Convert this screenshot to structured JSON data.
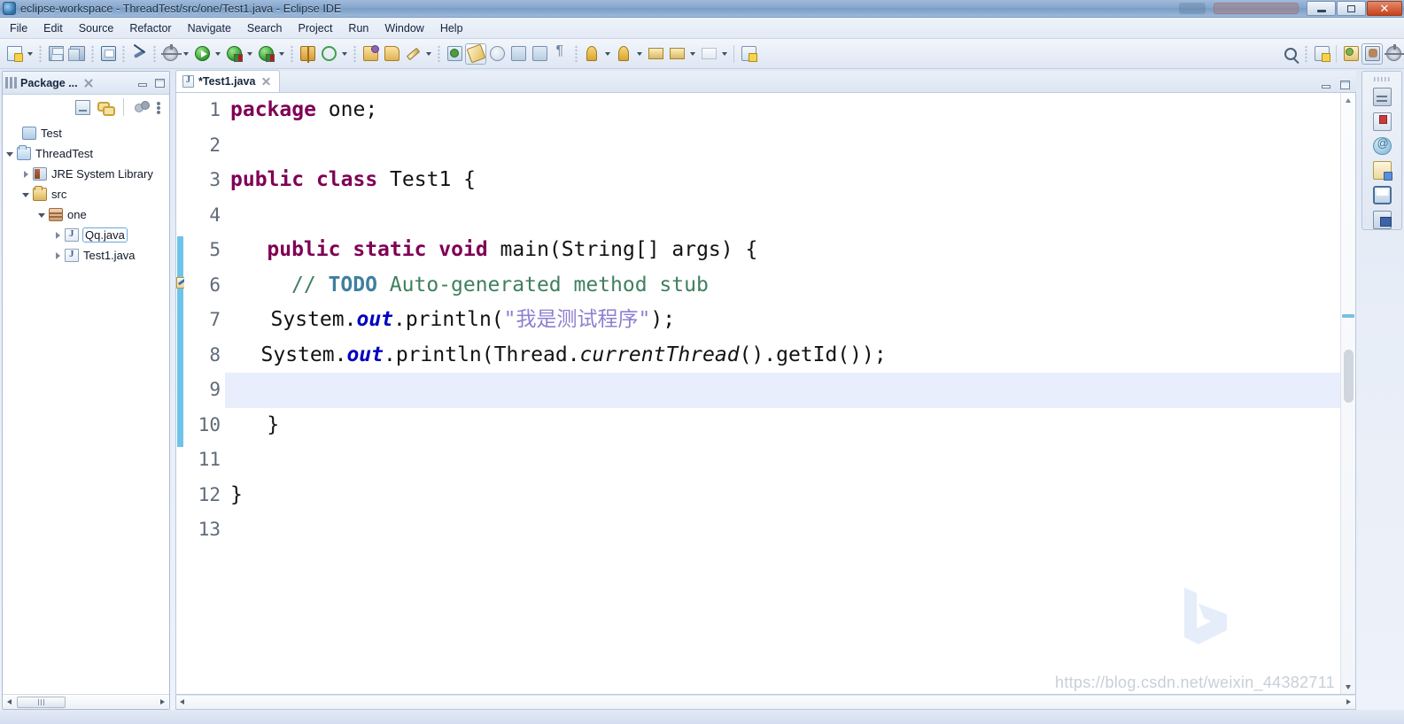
{
  "window": {
    "title": "eclipse-workspace - ThreadTest/src/one/Test1.java - Eclipse IDE",
    "app_icon": "eclipse-icon",
    "minimize_label": "",
    "maximize_label": "",
    "close_label": "✕"
  },
  "menubar": {
    "items": [
      {
        "label": "File",
        "name": "menu-file"
      },
      {
        "label": "Edit",
        "name": "menu-edit"
      },
      {
        "label": "Source",
        "name": "menu-source"
      },
      {
        "label": "Refactor",
        "name": "menu-refactor"
      },
      {
        "label": "Navigate",
        "name": "menu-navigate"
      },
      {
        "label": "Search",
        "name": "menu-search"
      },
      {
        "label": "Project",
        "name": "menu-project"
      },
      {
        "label": "Run",
        "name": "menu-run"
      },
      {
        "label": "Window",
        "name": "menu-window"
      },
      {
        "label": "Help",
        "name": "menu-help"
      }
    ]
  },
  "toolbar": {
    "icons": [
      "new-file-icon",
      "save-icon",
      "save-all-icon",
      "print-icon",
      "skip-all-breakpoints-icon",
      "debug-icon",
      "run-icon",
      "run-as-icon",
      "debug-as-icon",
      "external-tools-icon",
      "refresh-icon",
      "open-resource-icon",
      "new-package-icon",
      "new-java-project-icon",
      "new-class-icon",
      "edit-icon",
      "open-type-icon",
      "toggle-markoccurrences-icon",
      "link-icon",
      "next-annotation-icon",
      "previous-annotation-icon",
      "last-edit-location-icon",
      "back-icon",
      "forward-icon",
      "open-perspective-icon",
      "search-icon",
      "new-window-icon",
      "perspective-java-icon",
      "perspective-debug-icon",
      "perspective-extra-icon"
    ]
  },
  "explorer": {
    "tab_label": "Package ...",
    "tab_icon": "package-explorer-icon",
    "close_icon": "close-icon",
    "minimize_icon": "minimize-icon",
    "maximize_icon": "maximize-icon",
    "tools": [
      "collapse-all-icon",
      "link-with-editor-icon",
      "focus-on-active-task-icon",
      "view-menu-icon"
    ],
    "tree": [
      {
        "label": "Test",
        "icon": "project-closed-icon",
        "indent": 0,
        "twisty": "none",
        "selected": false
      },
      {
        "label": "ThreadTest",
        "icon": "project-open-icon",
        "indent": 0,
        "twisty": "open",
        "selected": false
      },
      {
        "label": "JRE System Library",
        "icon": "library-icon",
        "indent": 1,
        "twisty": "closed",
        "selected": false
      },
      {
        "label": "src",
        "icon": "source-folder-icon",
        "indent": 1,
        "twisty": "open",
        "selected": false
      },
      {
        "label": "one",
        "icon": "package-icon",
        "indent": 2,
        "twisty": "open",
        "selected": false
      },
      {
        "label": "Qq.java",
        "icon": "java-file-icon",
        "indent": 3,
        "twisty": "closed",
        "selected": true
      },
      {
        "label": "Test1.java",
        "icon": "java-file-icon",
        "indent": 3,
        "twisty": "closed",
        "selected": false
      }
    ],
    "scroll_left_icon": "scroll-left-icon",
    "scroll_right_icon": "scroll-right-icon"
  },
  "editor": {
    "tab_label": "*Test1.java",
    "tab_icon": "java-file-icon",
    "tab_close_icon": "close-icon",
    "minimize_icon": "minimize-icon",
    "maximize_icon": "maximize-icon",
    "current_line": 9,
    "line_numbers": [
      "1",
      "2",
      "3",
      "4",
      "5",
      "6",
      "7",
      "8",
      "9",
      "10",
      "11",
      "12",
      "13"
    ],
    "fold_marker_line": 5,
    "lines": [
      {
        "n": "1",
        "indent": 0,
        "tokens": [
          {
            "t": "package",
            "c": "kw"
          },
          {
            "t": " one;",
            "c": ""
          }
        ]
      },
      {
        "n": "2",
        "indent": 0,
        "tokens": []
      },
      {
        "n": "3",
        "indent": 0,
        "tokens": [
          {
            "t": "public",
            "c": "kw"
          },
          {
            "t": " ",
            "c": ""
          },
          {
            "t": "class",
            "c": "kw"
          },
          {
            "t": " Test1 {",
            "c": ""
          }
        ]
      },
      {
        "n": "4",
        "indent": 0,
        "tokens": []
      },
      {
        "n": "5",
        "indent": 3,
        "tokens": [
          {
            "t": "public",
            "c": "kw"
          },
          {
            "t": " ",
            "c": ""
          },
          {
            "t": "static",
            "c": "kw"
          },
          {
            "t": " ",
            "c": ""
          },
          {
            "t": "void",
            "c": "kw"
          },
          {
            "t": " main(String[] args) {",
            "c": ""
          }
        ]
      },
      {
        "n": "6",
        "indent": 5,
        "tokens": [
          {
            "t": "// ",
            "c": "cmt"
          },
          {
            "t": "TODO",
            "c": "task"
          },
          {
            "t": " Auto-generated method stub",
            "c": "cmt"
          }
        ]
      },
      {
        "n": "7",
        "indent": 3.3,
        "tokens": [
          {
            "t": "System.",
            "c": ""
          },
          {
            "t": "out",
            "c": "sfld"
          },
          {
            "t": ".println(",
            "c": ""
          },
          {
            "t": "\"我是测试程序\"",
            "c": "str"
          },
          {
            "t": ");",
            "c": ""
          }
        ]
      },
      {
        "n": "8",
        "indent": 2.5,
        "tokens": [
          {
            "t": "System.",
            "c": ""
          },
          {
            "t": "out",
            "c": "sfld"
          },
          {
            "t": ".println(Thread.",
            "c": ""
          },
          {
            "t": "currentThread",
            "c": "smth"
          },
          {
            "t": "().getId());",
            "c": ""
          }
        ]
      },
      {
        "n": "9",
        "indent": 0,
        "tokens": []
      },
      {
        "n": "10",
        "indent": 3,
        "tokens": [
          {
            "t": "}",
            "c": ""
          }
        ]
      },
      {
        "n": "11",
        "indent": 0,
        "tokens": []
      },
      {
        "n": "12",
        "indent": 0,
        "tokens": [
          {
            "t": "}",
            "c": ""
          }
        ]
      },
      {
        "n": "13",
        "indent": 0,
        "tokens": []
      }
    ],
    "scroll_up_icon": "scroll-up-icon",
    "scroll_down_icon": "scroll-down-icon",
    "scroll_left_icon": "scroll-left-icon",
    "scroll_right_icon": "scroll-right-icon"
  },
  "right_rail": {
    "icons": [
      "outline-view-icon",
      "task-list-icon",
      "javadoc-view-icon",
      "declaration-view-icon",
      "console-view-icon",
      "servers-view-icon"
    ]
  },
  "watermark": {
    "text": "https://blog.csdn.net/weixin_44382711"
  },
  "colors": {
    "keyword": "#7f0055",
    "comment": "#3f7f5f",
    "task_tag": "#3f7f9f",
    "string": "#8f7fd0",
    "static_field": "#0000c0",
    "current_line_bg": "#e8eefb",
    "change_bar": "#6ec4e8",
    "titlebar": "#86a7cc",
    "close_button": "#c6421f"
  }
}
